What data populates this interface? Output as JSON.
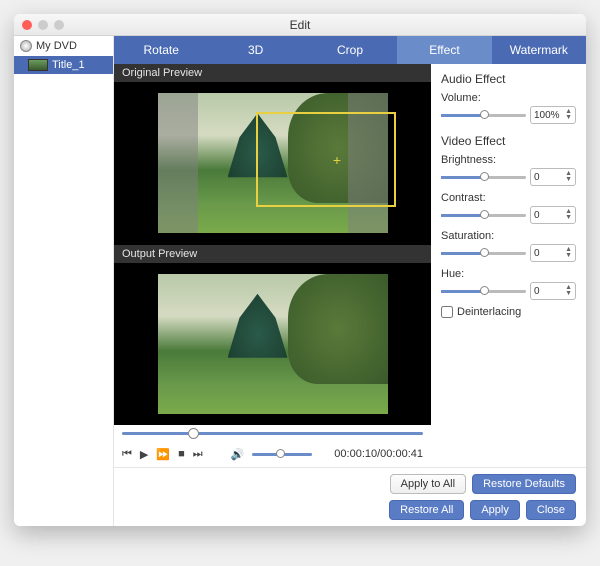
{
  "window": {
    "title": "Edit"
  },
  "sidebar": {
    "disc": "My DVD",
    "items": [
      {
        "label": "Title_1"
      }
    ]
  },
  "tabs": [
    {
      "label": "Rotate",
      "active": false
    },
    {
      "label": "3D",
      "active": false
    },
    {
      "label": "Crop",
      "active": false
    },
    {
      "label": "Effect",
      "active": true
    },
    {
      "label": "Watermark",
      "active": false
    }
  ],
  "preview": {
    "original_label": "Original Preview",
    "output_label": "Output Preview"
  },
  "playback": {
    "time": "00:00:10/00:00:41"
  },
  "effects": {
    "audio_header": "Audio Effect",
    "volume_label": "Volume:",
    "volume_value": "100%",
    "video_header": "Video Effect",
    "brightness_label": "Brightness:",
    "brightness_value": "0",
    "contrast_label": "Contrast:",
    "contrast_value": "0",
    "saturation_label": "Saturation:",
    "saturation_value": "0",
    "hue_label": "Hue:",
    "hue_value": "0",
    "deinterlacing_label": "Deinterlacing"
  },
  "footer": {
    "apply_all": "Apply to All",
    "restore_defaults": "Restore Defaults",
    "restore_all": "Restore All",
    "apply": "Apply",
    "close": "Close"
  }
}
